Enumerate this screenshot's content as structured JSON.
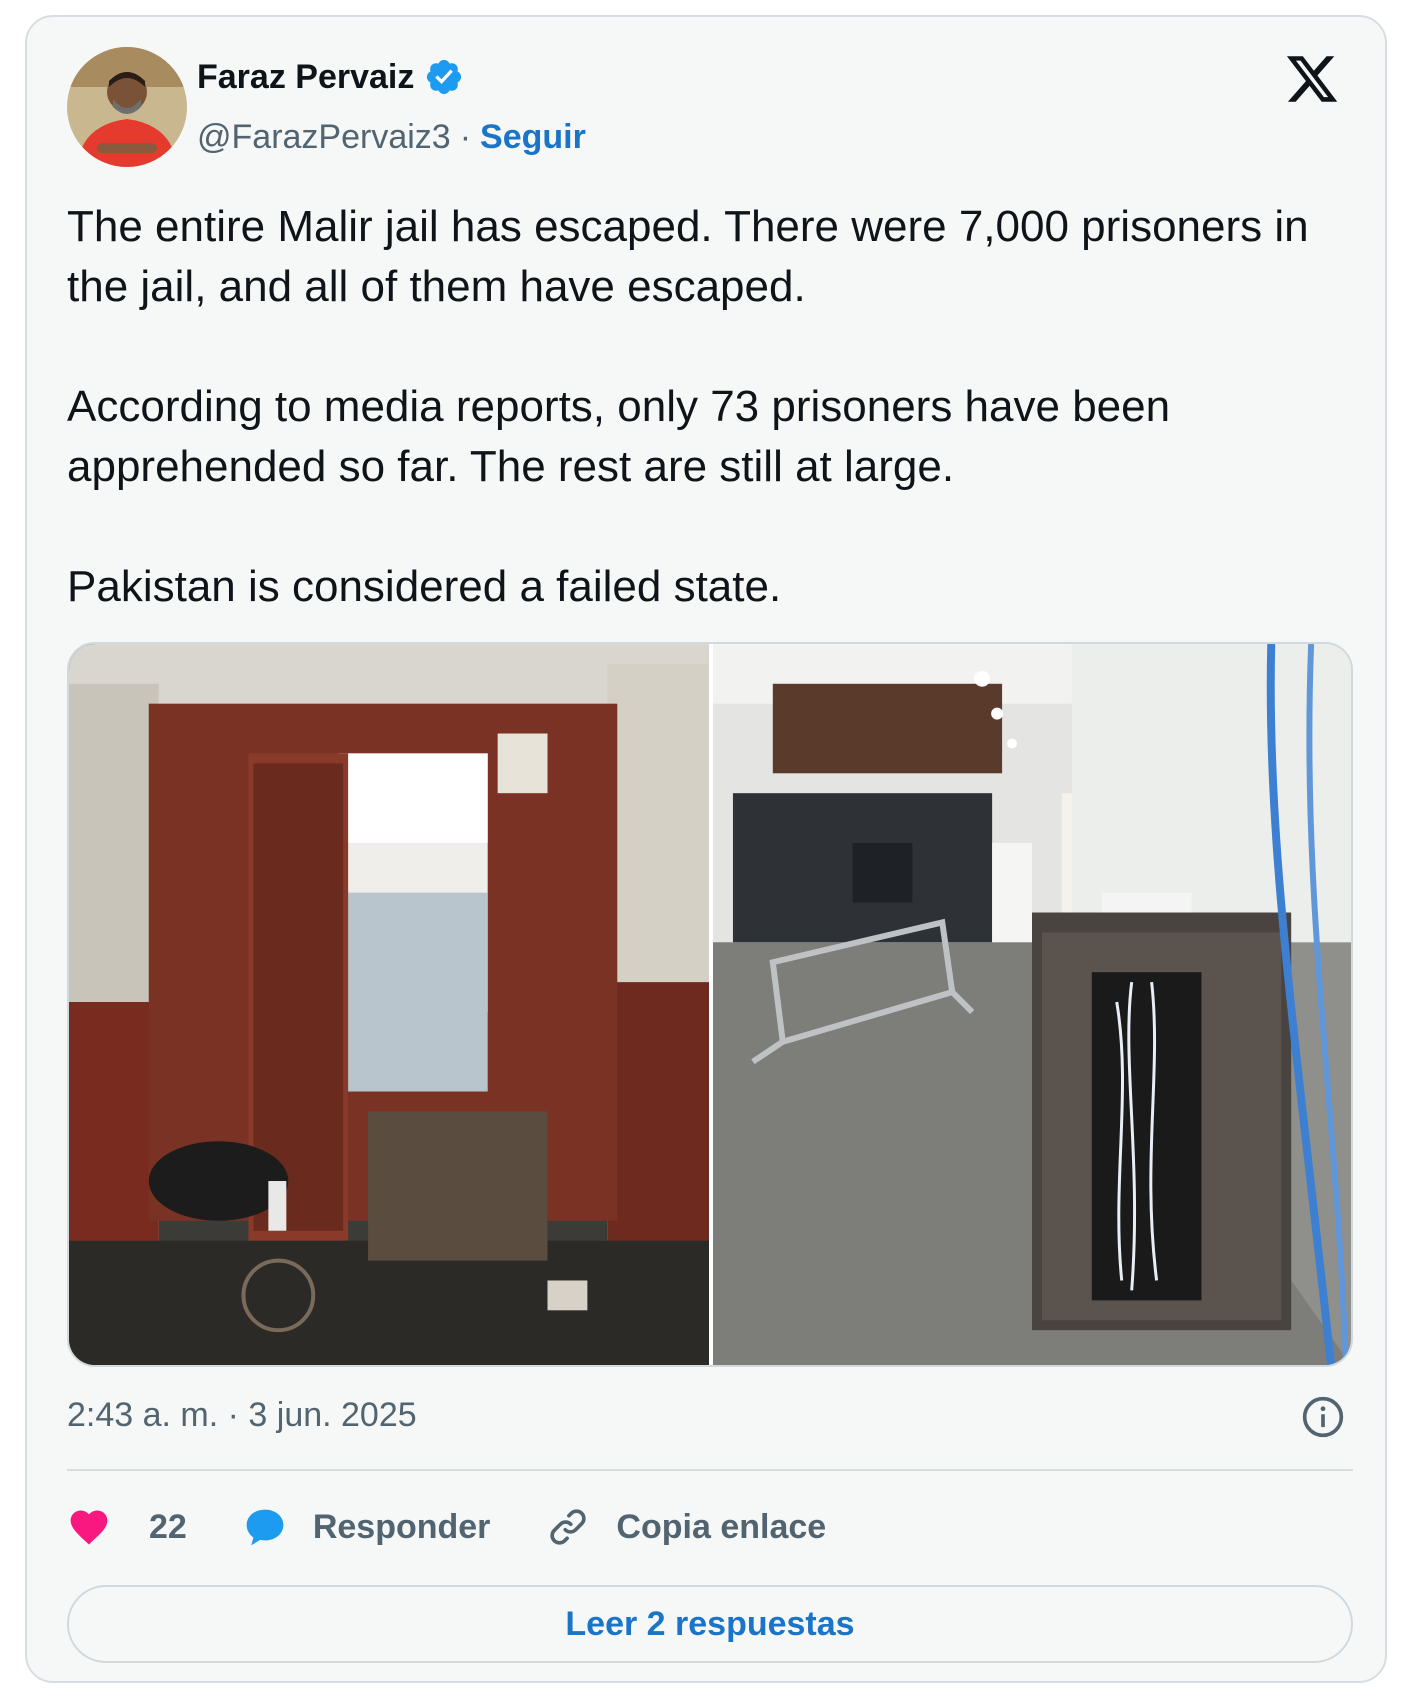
{
  "author": {
    "name": "Faraz Pervaiz",
    "handle": "@FarazPervaiz3",
    "separator": "·",
    "follow_label": "Seguir",
    "verified": true
  },
  "tweet": {
    "paragraphs": [
      "The entire Malir jail has escaped. There were 7,000 prisoners in the jail, and all of them have escaped.",
      "According to media reports, only 73 prisoners have been apprehended so far. The rest are still at large.",
      "Pakistan is considered a failed state."
    ],
    "timestamp": "2:43 a. m. · 3 jun. 2025"
  },
  "actions": {
    "like_count": "22",
    "reply_label": "Responder",
    "copy_link_label": "Copia enlace"
  },
  "read_replies_label": "Leer 2 respuestas",
  "icons": {
    "platform_logo": "x-logo-icon",
    "verified": "verified-badge-icon",
    "info": "info-icon",
    "like": "heart-icon",
    "reply": "speech-bubble-icon",
    "copy_link": "link-icon"
  },
  "colors": {
    "card_background": "#f6f7f7",
    "link_blue": "#1a74c8",
    "verified_blue": "#1d9bf0",
    "like_pink": "#f91880",
    "muted_text": "#536471"
  }
}
